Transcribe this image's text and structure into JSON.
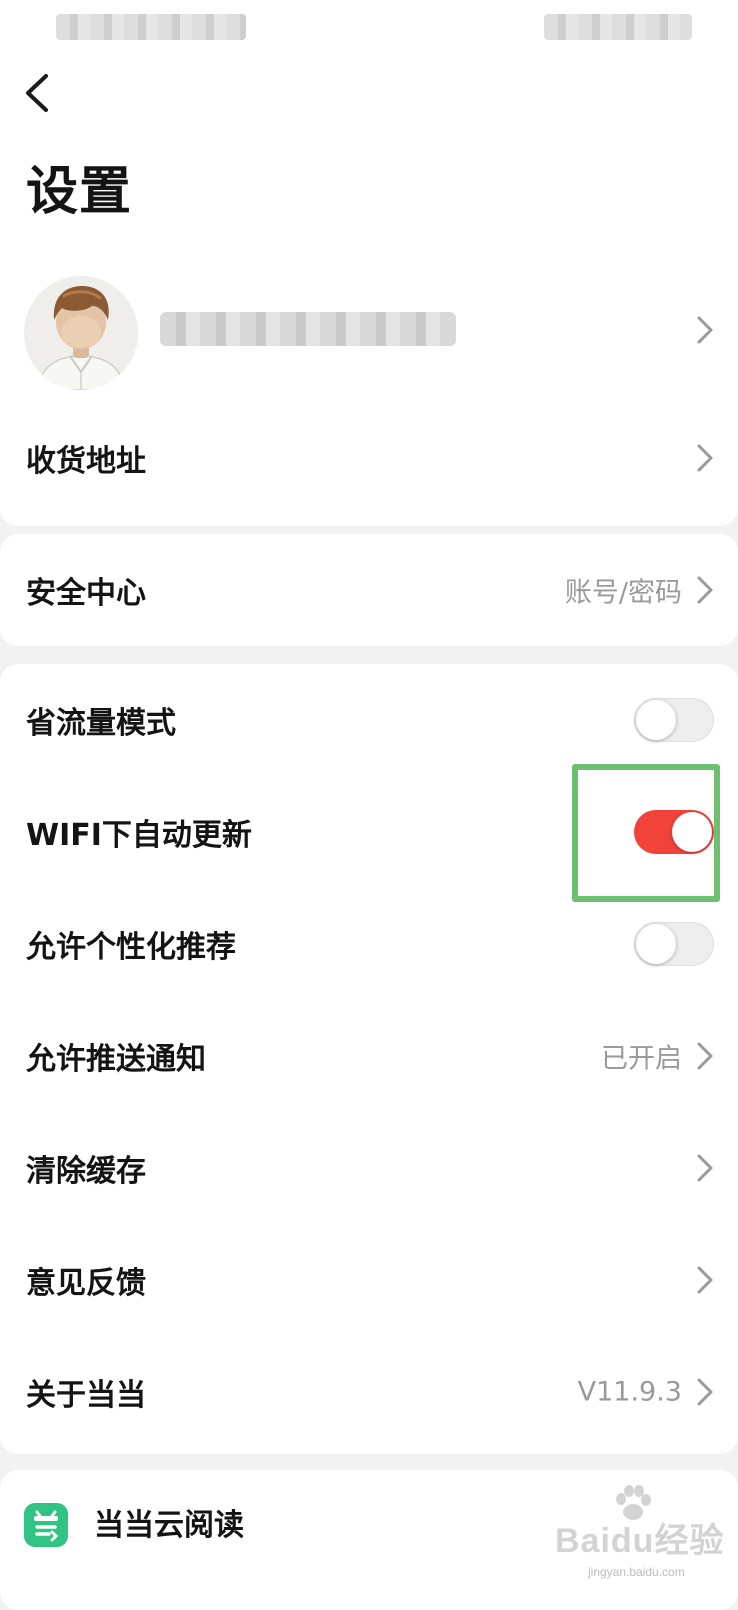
{
  "page": {
    "title": "设置"
  },
  "profile": {
    "has_chevron": true
  },
  "account_section": {
    "shipping_address_label": "收货地址"
  },
  "security": {
    "label": "安全中心",
    "value": "账号/密码"
  },
  "settings": {
    "data_saver_label": "省流量模式",
    "data_saver_on": false,
    "wifi_update_label": "WIFI下自动更新",
    "wifi_update_on": true,
    "personalized_label": "允许个性化推荐",
    "personalized_on": false,
    "push_label": "允许推送通知",
    "push_value": "已开启",
    "clear_cache_label": "清除缓存",
    "feedback_label": "意见反馈",
    "about_label": "关于当当",
    "about_value": "V11.9.3"
  },
  "reader": {
    "label": "当当云阅读"
  },
  "watermark": {
    "text": "Baidu经验",
    "url": "jingyan.baidu.com"
  },
  "colors": {
    "toggle_on": "#f2433b",
    "toggle_off": "#eeeeee",
    "highlight": "#6cc070",
    "reader_icon": "#2fc384",
    "secondary_text": "#9a9a9a"
  },
  "icons": {
    "back": "chevron-left-icon",
    "row_arrow": "chevron-right-icon",
    "reader": "dangdang-reader-icon"
  }
}
